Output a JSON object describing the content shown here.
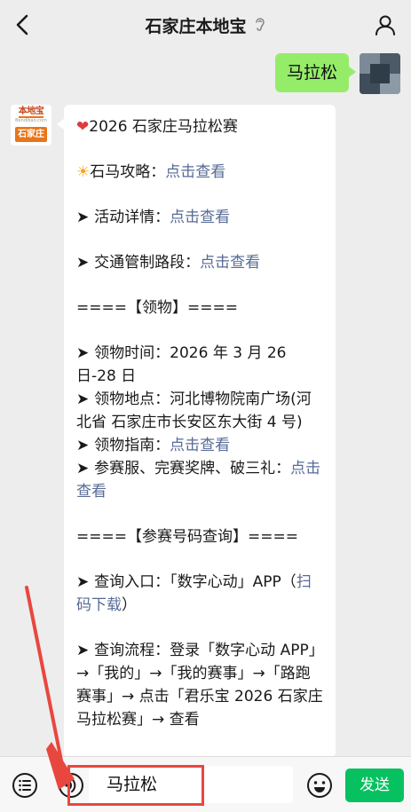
{
  "header": {
    "title": "石家庄本地宝"
  },
  "outgoing_message": {
    "text": "马拉松"
  },
  "incoming_avatar": {
    "brand": "本地宝",
    "url": "Bendibao.com",
    "city": "石家庄"
  },
  "incoming_message": {
    "event_title": "2026 石家庄马拉松赛",
    "l_guide": "石马攻略：",
    "l_activity": "活动详情：",
    "l_traffic": "交通管制路段：",
    "link_text": "点击查看",
    "pickup_header": "====【领物】====",
    "pickup_time": "领物时间：2026 年 3 月 26 日-28 日",
    "pickup_place": "领物地点：河北博物院南广场(河北省 石家庄市长安区东大街 4 号)",
    "l_pickup_guide": "领物指南：",
    "l_kit": "参赛服、完赛奖牌、破三礼：",
    "bib_header": "====【参赛号码查询】====",
    "l_entry": "查询入口：「数字心动」APP（",
    "scan_link": "扫码下载",
    "entry_close": "）",
    "process": "查询流程：登录「数字心动 APP」→「我的」→「我的赛事」→「路跑赛事」→ 点击「君乐宝 2026 石家庄马拉松赛」→ 查看"
  },
  "input_bar": {
    "value": "马拉松",
    "send_label": "发送"
  },
  "colors": {
    "accent_green": "#07c160",
    "bubble_green": "#95ec69",
    "link_blue": "#576b95",
    "annotation_red": "#e8473f"
  },
  "icons": [
    "back-icon",
    "ear-icon",
    "user-icon",
    "menu-icon",
    "voice-icon",
    "emoji-icon"
  ]
}
